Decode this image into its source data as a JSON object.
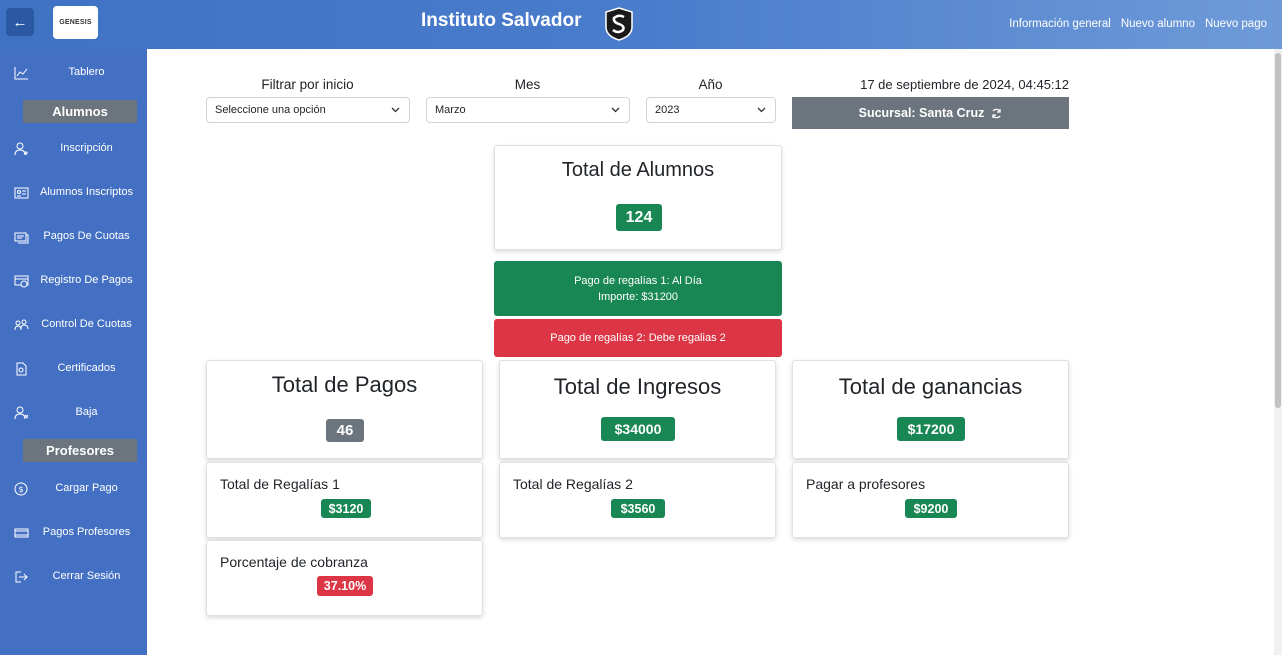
{
  "header": {
    "logo_text": "GENESIS",
    "title": "Instituto Salvador",
    "nav": [
      "Información general",
      "Nuevo alumno",
      "Nuevo pago"
    ]
  },
  "sidebar": {
    "items": [
      {
        "label": "Tablero",
        "icon": "chart-line-icon"
      },
      {
        "header": "Alumnos"
      },
      {
        "label": "Inscripción",
        "icon": "user-plus-icon"
      },
      {
        "label": "Alumnos Inscriptos",
        "icon": "id-card-icon"
      },
      {
        "label": "Pagos De Cuotas",
        "icon": "receipt-icon"
      },
      {
        "label": "Registro De Pagos",
        "icon": "payment-register-icon"
      },
      {
        "label": "Control De Cuotas",
        "icon": "people-control-icon"
      },
      {
        "label": "Certificados",
        "icon": "certificate-icon"
      },
      {
        "label": "Baja",
        "icon": "user-x-icon"
      },
      {
        "header": "Profesores"
      },
      {
        "label": "Cargar Pago",
        "icon": "dollar-circle-icon"
      },
      {
        "label": "Pagos Profesores",
        "icon": "cash-icon"
      },
      {
        "label": "Cerrar Sesión",
        "icon": "logout-icon"
      }
    ]
  },
  "filters": {
    "inicio": {
      "label": "Filtrar por inicio",
      "value": "Seleccione una opción"
    },
    "mes": {
      "label": "Mes",
      "value": "Marzo"
    },
    "anio": {
      "label": "Año",
      "value": "2023"
    }
  },
  "datetime": "17 de septiembre de 2024, 04:45:12",
  "branch": "Sucursal: Santa Cruz",
  "total_alumnos": {
    "title": "Total de Alumnos",
    "value": "124"
  },
  "alerts": {
    "regalias1": {
      "line1": "Pago de regalías 1: Al Día",
      "line2": "Importe: $31200",
      "color": "#198754"
    },
    "regalias2": {
      "line1": "Pago de regalías 2: Debe regalias 2",
      "color": "#dc3545"
    }
  },
  "totals": {
    "pagos": {
      "title": "Total de Pagos",
      "value": "46"
    },
    "ingresos": {
      "title": "Total de Ingresos",
      "value": "$34000"
    },
    "ganancias": {
      "title": "Total de ganancias",
      "value": "$17200"
    }
  },
  "details": {
    "regalias1": {
      "title": "Total de Regalías 1",
      "value": "$3120"
    },
    "regalias2": {
      "title": "Total de Regalías 2",
      "value": "$3560"
    },
    "profesores": {
      "title": "Pagar a profesores",
      "value": "$9200"
    },
    "cobranza": {
      "title": "Porcentaje de cobranza",
      "value": "37.10%"
    }
  },
  "colors": {
    "header": "#4a7ccc",
    "sidebar": "#4470c4",
    "success": "#198754",
    "danger": "#dc3545",
    "secondary": "#6c757d"
  }
}
